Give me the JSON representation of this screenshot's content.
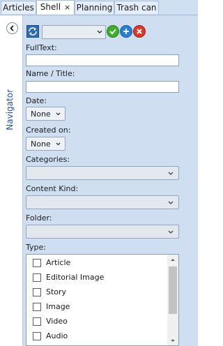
{
  "tabs": [
    {
      "label": "Articles"
    },
    {
      "label": "Shell",
      "close": "×"
    },
    {
      "label": "Planning"
    },
    {
      "label": "Trash can"
    }
  ],
  "navigator": {
    "label": "Navigator"
  },
  "form": {
    "fulltext_label": "FullText:",
    "fulltext_value": "",
    "name_label": "Name / Title:",
    "name_value": "",
    "date_label": "Date:",
    "date_value": "None",
    "created_label": "Created on:",
    "created_value": "None",
    "categories_label": "Categories:",
    "categories_value": "",
    "content_kind_label": "Content Kind:",
    "content_kind_value": "",
    "folder_label": "Folder:",
    "folder_value": "",
    "type_label": "Type:",
    "type_items": [
      {
        "label": "Article",
        "checked": false
      },
      {
        "label": "Editorial Image",
        "checked": false
      },
      {
        "label": "Story",
        "checked": false
      },
      {
        "label": "Image",
        "checked": false
      },
      {
        "label": "Video",
        "checked": false
      },
      {
        "label": "Audio",
        "checked": false
      }
    ]
  },
  "toolbar": {
    "saved_search_value": "",
    "icons": [
      "refresh-icon",
      "check-icon",
      "add-icon",
      "delete-icon"
    ],
    "colors": {
      "check": "#3fae2a",
      "add": "#2a7fd4",
      "delete": "#d63a2a"
    }
  }
}
